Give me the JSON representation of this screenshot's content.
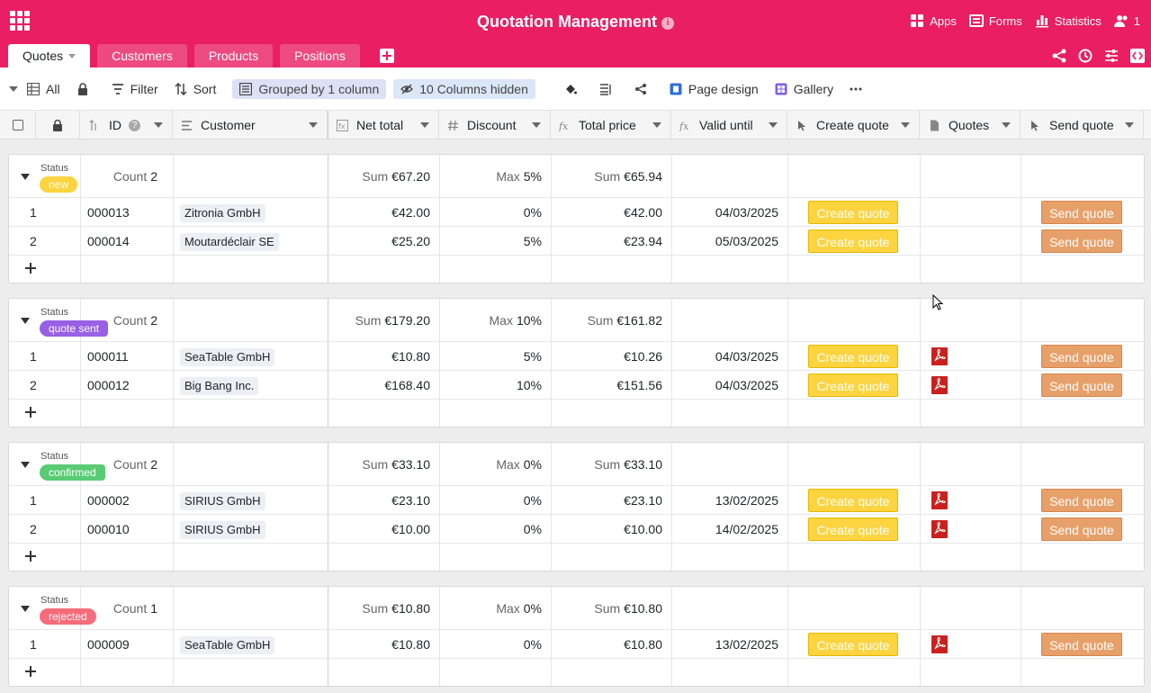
{
  "header": {
    "title": "Quotation Management",
    "apps": "Apps",
    "forms": "Forms",
    "statistics": "Statistics",
    "users_count": "1"
  },
  "tabs": [
    {
      "label": "Quotes",
      "active": true
    },
    {
      "label": "Customers"
    },
    {
      "label": "Products"
    },
    {
      "label": "Positions"
    }
  ],
  "toolbar": {
    "view": "All",
    "filter": "Filter",
    "sort": "Sort",
    "grouped": "Grouped by 1 column",
    "hidden": "10 Columns hidden",
    "page_design": "Page design",
    "gallery": "Gallery"
  },
  "columns": {
    "id": "ID",
    "customer": "Customer",
    "net_total": "Net total",
    "discount": "Discount",
    "total_price": "Total price",
    "valid_until": "Valid until",
    "create_quote": "Create quote",
    "quotes": "Quotes",
    "send_quote": "Send quote"
  },
  "labels": {
    "status": "Status",
    "count": "Count",
    "sum": "Sum",
    "max": "Max",
    "create_btn": "Create quote",
    "send_btn": "Send quote"
  },
  "colors": {
    "brand": "#e91e63",
    "new": "#fcd440",
    "quote_sent": "#9860e5",
    "confirmed": "#59cb74",
    "rejected": "#f66c7b"
  },
  "groups": [
    {
      "status": "new",
      "count": "2",
      "sum_net": "€67.20",
      "max_discount": "5%",
      "sum_total": "€65.94",
      "rows": [
        {
          "n": "1",
          "id": "000013",
          "customer": "Zitronia GmbH",
          "net": "€42.00",
          "discount": "0%",
          "total": "€42.00",
          "valid": "04/03/2025",
          "pdf": false
        },
        {
          "n": "2",
          "id": "000014",
          "customer": "Moutardéclair SE",
          "net": "€25.20",
          "discount": "5%",
          "total": "€23.94",
          "valid": "05/03/2025",
          "pdf": false
        }
      ]
    },
    {
      "status": "quote sent",
      "count": "2",
      "sum_net": "€179.20",
      "max_discount": "10%",
      "sum_total": "€161.82",
      "rows": [
        {
          "n": "1",
          "id": "000011",
          "customer": "SeaTable GmbH",
          "net": "€10.80",
          "discount": "5%",
          "total": "€10.26",
          "valid": "04/03/2025",
          "pdf": true
        },
        {
          "n": "2",
          "id": "000012",
          "customer": "Big Bang Inc.",
          "net": "€168.40",
          "discount": "10%",
          "total": "€151.56",
          "valid": "04/03/2025",
          "pdf": true
        }
      ]
    },
    {
      "status": "confirmed",
      "count": "2",
      "sum_net": "€33.10",
      "max_discount": "0%",
      "sum_total": "€33.10",
      "rows": [
        {
          "n": "1",
          "id": "000002",
          "customer": "SIRIUS GmbH",
          "net": "€23.10",
          "discount": "0%",
          "total": "€23.10",
          "valid": "13/02/2025",
          "pdf": true
        },
        {
          "n": "2",
          "id": "000010",
          "customer": "SIRIUS GmbH",
          "net": "€10.00",
          "discount": "0%",
          "total": "€10.00",
          "valid": "14/02/2025",
          "pdf": true
        }
      ]
    },
    {
      "status": "rejected",
      "count": "1",
      "sum_net": "€10.80",
      "max_discount": "0%",
      "sum_total": "€10.80",
      "rows": [
        {
          "n": "1",
          "id": "000009",
          "customer": "SeaTable GmbH",
          "net": "€10.80",
          "discount": "0%",
          "total": "€10.80",
          "valid": "13/02/2025",
          "pdf": true
        }
      ]
    }
  ]
}
